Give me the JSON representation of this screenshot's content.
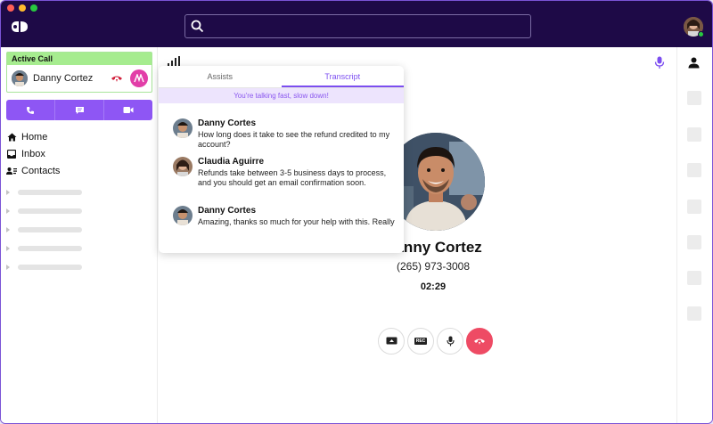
{
  "sidebar": {
    "active_call": {
      "header": "Active Call",
      "caller": "Danny Cortez"
    },
    "nav": [
      {
        "label": "Home",
        "icon": "home-icon"
      },
      {
        "label": "Inbox",
        "icon": "inbox-icon"
      },
      {
        "label": "Contacts",
        "icon": "contacts-icon"
      }
    ]
  },
  "transcript_panel": {
    "tabs": [
      "Assists",
      "Transcript"
    ],
    "active_tab": "Transcript",
    "alert": "You're talking fast, slow down!",
    "messages": [
      {
        "speaker": "Danny Cortes",
        "text": "How long does it take to see the refund credited to my account?"
      },
      {
        "speaker": "Claudia Aguirre",
        "text": "Refunds take between 3-5 business days to process, and you should get an email confirmation soon."
      },
      {
        "speaker": "Danny Cortes",
        "text": "Amazing, thanks so much for your help with this. Really"
      }
    ]
  },
  "call": {
    "name": "Danny Cortez",
    "phone": "(265) 973-3008",
    "timer": "02:29",
    "controls": [
      "screen-share",
      "record",
      "mute",
      "end-call"
    ],
    "rec_label": "REC"
  },
  "colors": {
    "titlebar": "#1e0a47",
    "accent": "#8e56f4",
    "active_call_green": "#a6ec8f",
    "end_call": "#ee4b64",
    "ai_button": "#e23ea8"
  }
}
